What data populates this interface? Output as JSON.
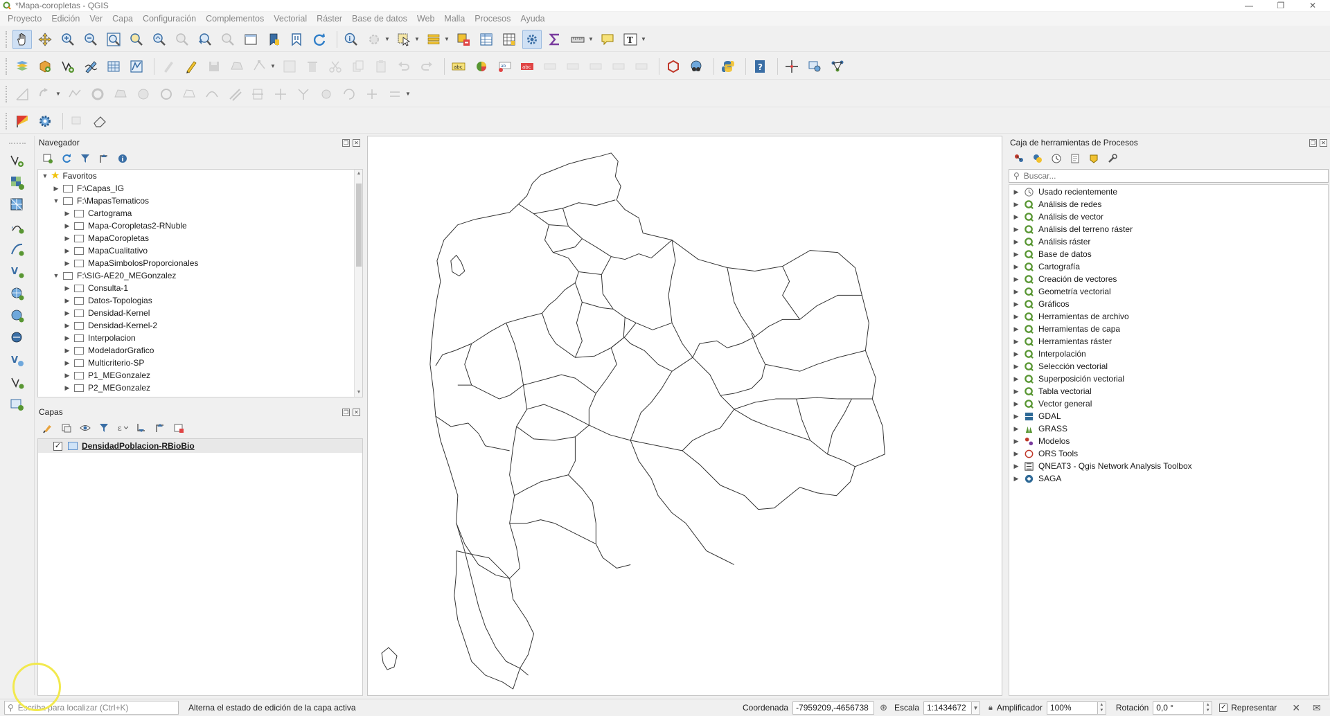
{
  "window": {
    "title": "*Mapa-coropletas - QGIS",
    "minimize": "—",
    "restore": "❐",
    "close": "✕"
  },
  "menu": [
    "Proyecto",
    "Edición",
    "Ver",
    "Capa",
    "Configuración",
    "Complementos",
    "Vectorial",
    "Ráster",
    "Base de datos",
    "Web",
    "Malla",
    "Procesos",
    "Ayuda"
  ],
  "browser": {
    "title": "Navegador",
    "items": [
      {
        "label": "Favoritos",
        "level": 0,
        "expanded": true,
        "icon": "star-icon"
      },
      {
        "label": "F:\\Capas_IG",
        "level": 1,
        "expanded": false,
        "icon": "folder-icon"
      },
      {
        "label": "F:\\MapasTematicos",
        "level": 1,
        "expanded": true,
        "icon": "folder-icon"
      },
      {
        "label": "Cartograma",
        "level": 2,
        "expanded": false,
        "icon": "folder-icon"
      },
      {
        "label": "Mapa-Coropletas2-RNuble",
        "level": 2,
        "expanded": false,
        "icon": "folder-icon"
      },
      {
        "label": "MapaCoropletas",
        "level": 2,
        "expanded": false,
        "icon": "folder-icon"
      },
      {
        "label": "MapaCualitativo",
        "level": 2,
        "expanded": false,
        "icon": "folder-icon"
      },
      {
        "label": "MapaSimbolosProporcionales",
        "level": 2,
        "expanded": false,
        "icon": "folder-icon"
      },
      {
        "label": "F:\\SIG-AE20_MEGonzalez",
        "level": 1,
        "expanded": true,
        "icon": "folder-icon"
      },
      {
        "label": "Consulta-1",
        "level": 2,
        "expanded": false,
        "icon": "folder-icon"
      },
      {
        "label": "Datos-Topologias",
        "level": 2,
        "expanded": false,
        "icon": "folder-icon"
      },
      {
        "label": "Densidad-Kernel",
        "level": 2,
        "expanded": false,
        "icon": "folder-icon"
      },
      {
        "label": "Densidad-Kernel-2",
        "level": 2,
        "expanded": false,
        "icon": "folder-icon"
      },
      {
        "label": "Interpolacion",
        "level": 2,
        "expanded": false,
        "icon": "folder-icon"
      },
      {
        "label": "ModeladorGrafico",
        "level": 2,
        "expanded": false,
        "icon": "folder-icon"
      },
      {
        "label": "Multicriterio-SP",
        "level": 2,
        "expanded": false,
        "icon": "folder-icon"
      },
      {
        "label": "P1_MEGonzalez",
        "level": 2,
        "expanded": false,
        "icon": "folder-icon"
      },
      {
        "label": "P2_MEGonzalez",
        "level": 2,
        "expanded": false,
        "icon": "folder-icon"
      }
    ]
  },
  "layers": {
    "title": "Capas",
    "items": [
      {
        "label": "DensidadPoblacion-RBioBio",
        "checked": true,
        "check_glyph": "✓"
      }
    ]
  },
  "toolbox": {
    "title": "Caja de herramientas de Procesos",
    "search_placeholder": "Buscar...",
    "items": [
      {
        "label": "Usado recientemente",
        "icon": "clock-icon"
      },
      {
        "label": "Análisis de redes",
        "icon": "qgis-icon"
      },
      {
        "label": "Análisis de vector",
        "icon": "qgis-icon"
      },
      {
        "label": "Análisis del terreno ráster",
        "icon": "qgis-icon"
      },
      {
        "label": "Análisis ráster",
        "icon": "qgis-icon"
      },
      {
        "label": "Base de datos",
        "icon": "qgis-icon"
      },
      {
        "label": "Cartografía",
        "icon": "qgis-icon"
      },
      {
        "label": "Creación de vectores",
        "icon": "qgis-icon"
      },
      {
        "label": "Geometría vectorial",
        "icon": "qgis-icon"
      },
      {
        "label": "Gráficos",
        "icon": "qgis-icon"
      },
      {
        "label": "Herramientas de archivo",
        "icon": "qgis-icon"
      },
      {
        "label": "Herramientas de capa",
        "icon": "qgis-icon"
      },
      {
        "label": "Herramientas ráster",
        "icon": "qgis-icon"
      },
      {
        "label": "Interpolación",
        "icon": "qgis-icon"
      },
      {
        "label": "Selección vectorial",
        "icon": "qgis-icon"
      },
      {
        "label": "Superposición vectorial",
        "icon": "qgis-icon"
      },
      {
        "label": "Tabla vectorial",
        "icon": "qgis-icon"
      },
      {
        "label": "Vector general",
        "icon": "qgis-icon"
      },
      {
        "label": "GDAL",
        "icon": "gdal-icon"
      },
      {
        "label": "GRASS",
        "icon": "grass-icon"
      },
      {
        "label": "Modelos",
        "icon": "models-icon"
      },
      {
        "label": "ORS Tools",
        "icon": "ors-icon"
      },
      {
        "label": "QNEAT3 - Qgis Network Analysis Toolbox",
        "icon": "qneat-icon"
      },
      {
        "label": "SAGA",
        "icon": "saga-icon"
      }
    ]
  },
  "status": {
    "locator_placeholder": "Escriba para localizar (Ctrl+K)",
    "message": "Alterna el estado de edición de la capa activa",
    "coordinate_label": "Coordenada",
    "coordinate_value": "-7959209,-4656738",
    "scale_label": "Escala",
    "scale_value": "1:1434672",
    "magnifier_label": "Amplificador",
    "magnifier_value": "100%",
    "rotation_label": "Rotación",
    "rotation_value": "0,0 °",
    "render_label": "Representar",
    "render_checked": true,
    "check_glyph": "✓"
  },
  "colors": {
    "accent": "#5b8ec9",
    "qgis_green": "#589632",
    "map_border": "#333333"
  }
}
